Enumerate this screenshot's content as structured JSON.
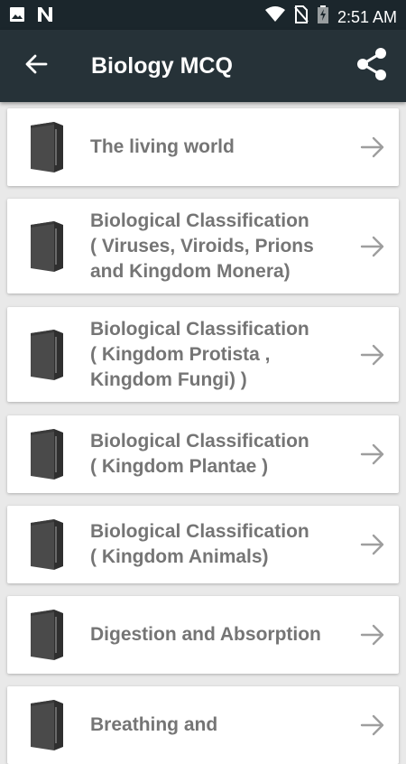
{
  "status_bar": {
    "time": "2:51 AM",
    "left_icons": [
      "image-icon",
      "n-app-icon"
    ],
    "right_icons": [
      "wifi-icon",
      "no-sim-icon",
      "battery-charging-icon"
    ]
  },
  "app_bar": {
    "title": "Biology MCQ",
    "back_icon": "arrow-left-icon",
    "share_icon": "share-icon",
    "background": "#263238"
  },
  "chapters": [
    {
      "lines": [
        "The living world"
      ]
    },
    {
      "lines": [
        "Biological Classification",
        "( Viruses, Viroids, Prions",
        "and Kingdom Monera)"
      ]
    },
    {
      "lines": [
        "Biological Classification",
        "( Kingdom Protista ,",
        "Kingdom Fungi) )"
      ]
    },
    {
      "lines": [
        "Biological Classification",
        "( Kingdom Plantae )"
      ]
    },
    {
      "lines": [
        "Biological Classification",
        "( Kingdom Animals)"
      ]
    },
    {
      "lines": [
        "Digestion and Absorption"
      ]
    },
    {
      "lines": [
        "Breathing and"
      ]
    }
  ],
  "colors": {
    "text": "#757575",
    "arrow": "#9e9e9e",
    "book": "#555555"
  }
}
